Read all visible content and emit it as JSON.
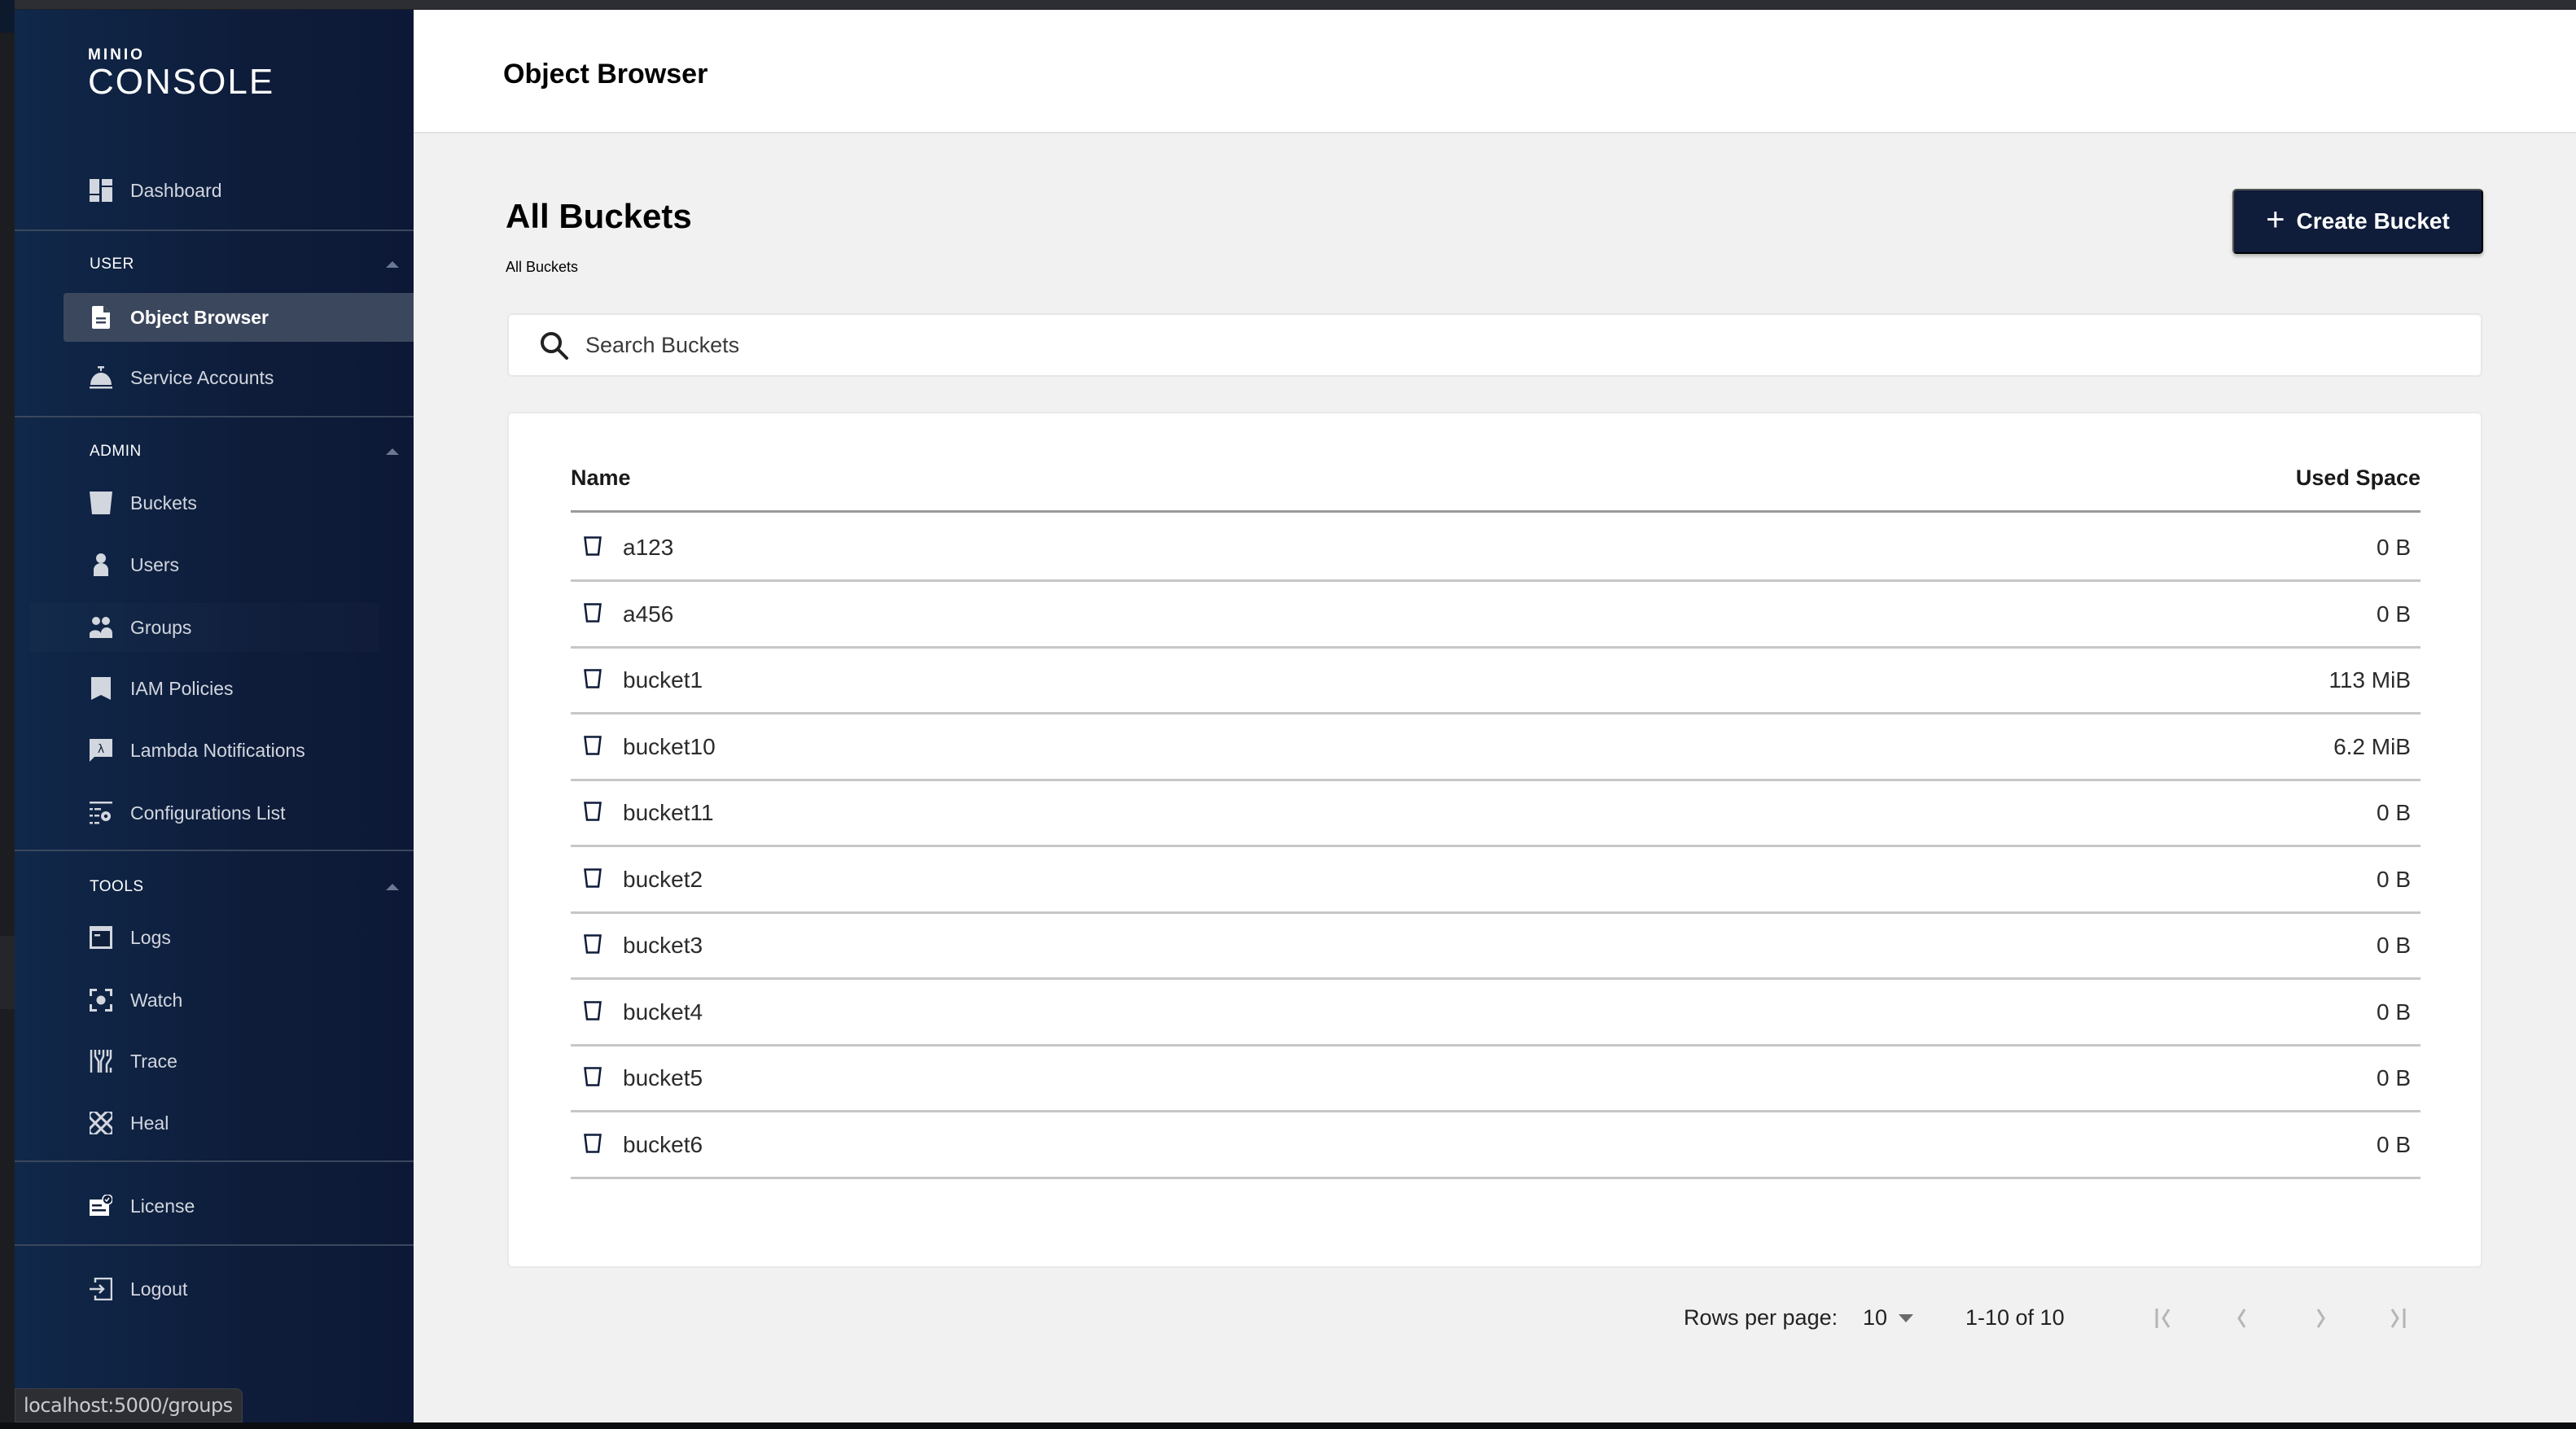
{
  "status_url": "localhost:5000/groups",
  "sidebar": {
    "logo_top": "MINIO",
    "logo_bottom": "CONSOLE",
    "dashboard": {
      "label": "Dashboard",
      "icon": "dashboard-icon"
    },
    "sections": [
      {
        "title": "USER",
        "items": [
          {
            "label": "Object Browser",
            "icon": "file-icon",
            "selected": true
          },
          {
            "label": "Service Accounts",
            "icon": "service-bell-icon"
          }
        ]
      },
      {
        "title": "ADMIN",
        "items": [
          {
            "label": "Buckets",
            "icon": "bucket-icon"
          },
          {
            "label": "Users",
            "icon": "user-icon"
          },
          {
            "label": "Groups",
            "icon": "groups-icon",
            "hovered": true
          },
          {
            "label": "IAM Policies",
            "icon": "bookmark-icon"
          },
          {
            "label": "Lambda Notifications",
            "icon": "lambda-icon"
          },
          {
            "label": "Configurations List",
            "icon": "config-list-icon"
          }
        ]
      },
      {
        "title": "TOOLS",
        "items": [
          {
            "label": "Logs",
            "icon": "logs-icon"
          },
          {
            "label": "Watch",
            "icon": "watch-icon"
          },
          {
            "label": "Trace",
            "icon": "trace-icon"
          },
          {
            "label": "Heal",
            "icon": "heal-icon"
          }
        ]
      }
    ],
    "license": {
      "label": "License",
      "icon": "license-icon"
    },
    "logout": {
      "label": "Logout",
      "icon": "logout-icon"
    }
  },
  "header": {
    "title": "Object Browser"
  },
  "content": {
    "title": "All Buckets",
    "breadcrumb": "All Buckets",
    "create_button": "Create Bucket",
    "search_placeholder": "Search Buckets"
  },
  "table": {
    "columns": [
      "Name",
      "Used Space"
    ],
    "rows": [
      {
        "name": "a123",
        "size": "0 B"
      },
      {
        "name": "a456",
        "size": "0 B"
      },
      {
        "name": "bucket1",
        "size": "113 MiB"
      },
      {
        "name": "bucket10",
        "size": "6.2 MiB"
      },
      {
        "name": "bucket11",
        "size": "0 B"
      },
      {
        "name": "bucket2",
        "size": "0 B"
      },
      {
        "name": "bucket3",
        "size": "0 B"
      },
      {
        "name": "bucket4",
        "size": "0 B"
      },
      {
        "name": "bucket5",
        "size": "0 B"
      },
      {
        "name": "bucket6",
        "size": "0 B"
      }
    ]
  },
  "pagination": {
    "rows_per_page_label": "Rows per page:",
    "rows_per_page": "10",
    "range": "1-10 of 10"
  },
  "colors": {
    "sidebar_bg": "#0f1e3a",
    "selected_bg": "#3b475d",
    "accent": "#0f1c3a",
    "page_bg": "#f1f1f1"
  }
}
